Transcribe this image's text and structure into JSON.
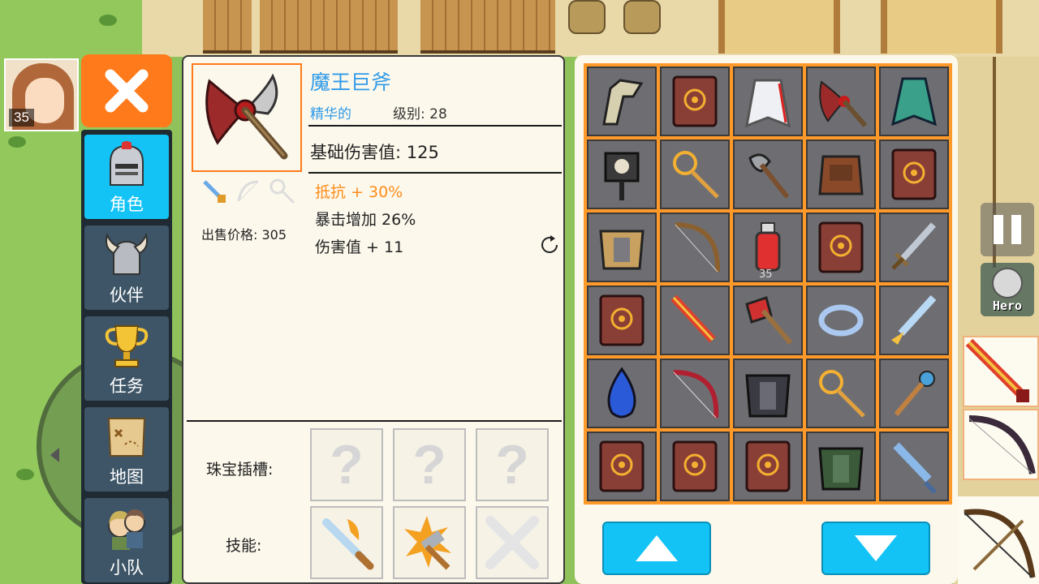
{
  "player": {
    "level": "35"
  },
  "side_tabs": [
    {
      "label": "角色",
      "icon": "knight-helmet-icon",
      "active": true
    },
    {
      "label": "伙伴",
      "icon": "horned-helmet-icon",
      "active": false
    },
    {
      "label": "任务",
      "icon": "trophy-icon",
      "active": false
    },
    {
      "label": "地图",
      "icon": "map-scroll-icon",
      "active": false
    },
    {
      "label": "小队",
      "icon": "party-icon",
      "active": false
    }
  ],
  "item": {
    "name": "魔王巨斧",
    "quality": "精华的",
    "level": "级别: 28",
    "base_damage": "基础伤害值: 125",
    "sell_price": "出售价格: 305",
    "stats": [
      {
        "text": "抵抗 + 30%",
        "color": "#ff8c1a"
      },
      {
        "text": "暴击增加 26%",
        "color": "#222222"
      },
      {
        "text": "伤害值 + 11",
        "color": "#222222"
      }
    ]
  },
  "sockets": {
    "gem_label": "珠宝插槽:",
    "skill_label": "技能:",
    "gem_placeholder": "?"
  },
  "inventory": {
    "items": [
      "claw-gauntlet-icon",
      "spell-book-icon",
      "white-cape-icon",
      "demon-axe-icon",
      "green-cloak-icon",
      "skull-mace-icon",
      "gold-staff-icon",
      "battle-axe-icon",
      "fur-armor-icon",
      "spell-book-icon",
      "gold-armor-icon",
      "wooden-bow-icon",
      "health-potion-icon",
      "spell-book-icon",
      "steel-sword-icon",
      "spell-book-icon",
      "flame-sword-icon",
      "cleaver-axe-icon",
      "silk-ring-icon",
      "winged-sword-icon",
      "sapphire-gem-icon",
      "red-bow-icon",
      "dark-armor-icon",
      "gold-staff-icon",
      "bronze-scepter-icon",
      "spell-book-icon",
      "spell-book-icon",
      "spell-book-icon",
      "green-armor-icon",
      "ice-sword-icon"
    ],
    "potion_count": "35"
  },
  "hud": {
    "hero_label": "Hero"
  },
  "colors": {
    "accent": "#13c3f5",
    "close": "#ff7a1a",
    "grid": "#ff9a2a",
    "name": "#2f9ae8"
  }
}
